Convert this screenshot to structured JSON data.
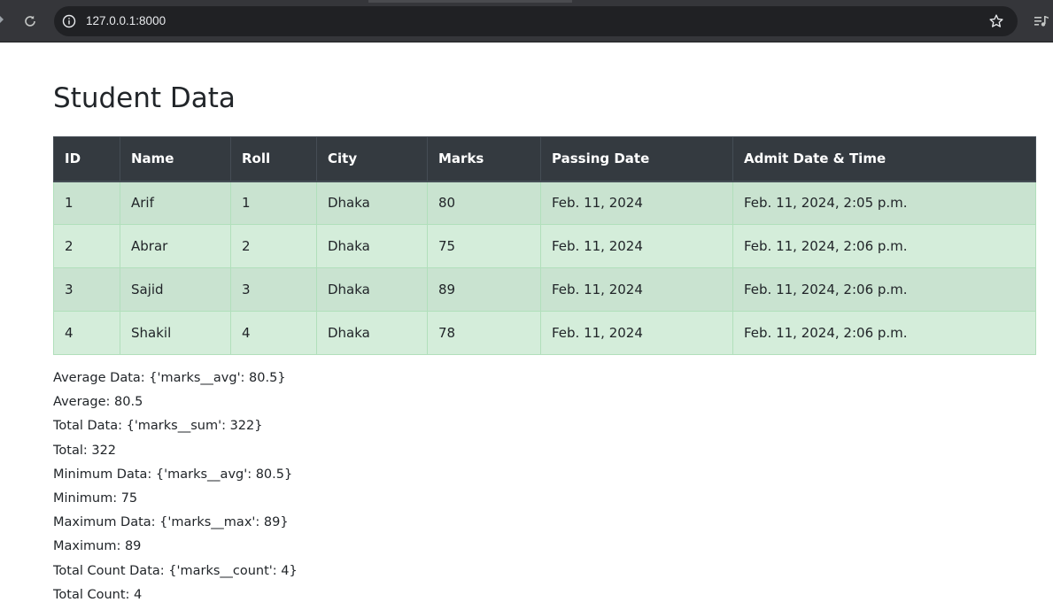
{
  "browser": {
    "url": "127.0.0.1:8000"
  },
  "page": {
    "title": "Student Data",
    "table": {
      "headers": [
        "ID",
        "Name",
        "Roll",
        "City",
        "Marks",
        "Passing Date",
        "Admit Date & Time"
      ],
      "rows": [
        [
          "1",
          "Arif",
          "1",
          "Dhaka",
          "80",
          "Feb. 11, 2024",
          "Feb. 11, 2024, 2:05 p.m."
        ],
        [
          "2",
          "Abrar",
          "2",
          "Dhaka",
          "75",
          "Feb. 11, 2024",
          "Feb. 11, 2024, 2:06 p.m."
        ],
        [
          "3",
          "Sajid",
          "3",
          "Dhaka",
          "89",
          "Feb. 11, 2024",
          "Feb. 11, 2024, 2:06 p.m."
        ],
        [
          "4",
          "Shakil",
          "4",
          "Dhaka",
          "78",
          "Feb. 11, 2024",
          "Feb. 11, 2024, 2:06 p.m."
        ]
      ]
    },
    "stats": [
      "Average Data: {'marks__avg': 80.5}",
      "Average: 80.5",
      "Total Data: {'marks__sum': 322}",
      "Total: 322",
      "Minimum Data: {'marks__avg': 80.5}",
      "Minimum: 75",
      "Maximum Data: {'marks__max': 89}",
      "Maximum: 89",
      "Total Count Data: {'marks__count': 4}",
      "Total Count: 4"
    ]
  },
  "colors": {
    "header_bg": "#343a40",
    "row_success": "#d4edda",
    "row_success_striped": "#c9e3d0",
    "chrome_bg": "#35363a",
    "omnibox_bg": "#202124"
  },
  "icons": [
    "forward-arrow-icon",
    "reload-icon",
    "site-info-icon",
    "bookmark-star-icon",
    "media-control-icon"
  ]
}
